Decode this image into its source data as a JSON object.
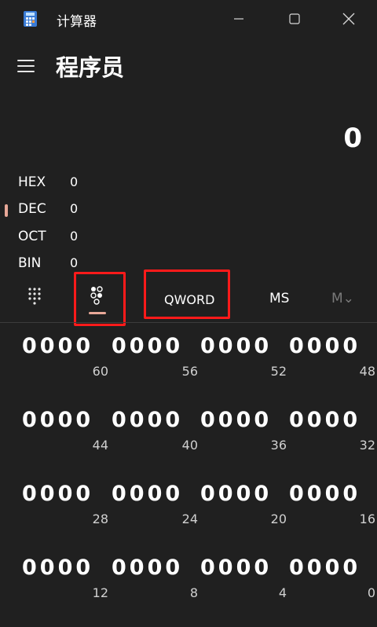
{
  "window": {
    "title": "计算器"
  },
  "header": {
    "mode_title": "程序员"
  },
  "display": {
    "value": "0"
  },
  "radix": [
    {
      "name": "HEX",
      "value": "0",
      "selected": false
    },
    {
      "name": "DEC",
      "value": "0",
      "selected": true
    },
    {
      "name": "OCT",
      "value": "0",
      "selected": false
    },
    {
      "name": "BIN",
      "value": "0",
      "selected": false
    }
  ],
  "toolbar": {
    "word_size": "QWORD",
    "memory_store": "MS",
    "memory_menu": "M⌄"
  },
  "colors": {
    "accent": "#e8a898",
    "highlight": "#ff1a1a",
    "background": "#202020"
  },
  "bits": [
    {
      "digits": "0000",
      "pos": "60"
    },
    {
      "digits": "0000",
      "pos": "56"
    },
    {
      "digits": "0000",
      "pos": "52"
    },
    {
      "digits": "0000",
      "pos": "48"
    },
    {
      "digits": "0000",
      "pos": "44"
    },
    {
      "digits": "0000",
      "pos": "40"
    },
    {
      "digits": "0000",
      "pos": "36"
    },
    {
      "digits": "0000",
      "pos": "32"
    },
    {
      "digits": "0000",
      "pos": "28"
    },
    {
      "digits": "0000",
      "pos": "24"
    },
    {
      "digits": "0000",
      "pos": "20"
    },
    {
      "digits": "0000",
      "pos": "16"
    },
    {
      "digits": "0000",
      "pos": "12"
    },
    {
      "digits": "0000",
      "pos": "8"
    },
    {
      "digits": "0000",
      "pos": "4"
    },
    {
      "digits": "0000",
      "pos": "0"
    }
  ]
}
